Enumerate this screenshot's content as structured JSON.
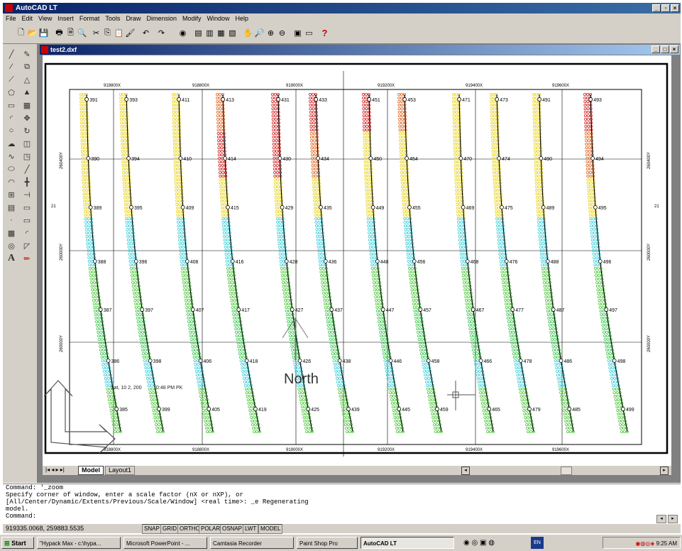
{
  "app": {
    "title": "AutoCAD LT"
  },
  "menu": [
    "File",
    "Edit",
    "View",
    "Insert",
    "Format",
    "Tools",
    "Draw",
    "Dimension",
    "Modify",
    "Window",
    "Help"
  ],
  "toolbar": {
    "help_glyph": "?"
  },
  "document": {
    "title": "test2.dxf"
  },
  "drawing": {
    "north_label": "North",
    "timestamp": "Sat, 10 2, 200",
    "timestamp2": "0:48 PM  PK",
    "x_labels_top": [
      "919800X",
      "918800X",
      "919000X",
      "919200X",
      "919400X",
      "919600X"
    ],
    "x_labels_bottom": [
      "918800X",
      "918800X",
      "919000X",
      "919200X",
      "919400X",
      "919600X"
    ],
    "y_labels_left": [
      "260400Y",
      "260000Y",
      "260000Y"
    ],
    "y_labels_right": [
      "260400Y",
      "260000Y",
      "260000Y"
    ],
    "label_21": "21",
    "lines": [
      {
        "stations": [
          "391",
          "390",
          "389",
          "388",
          "387",
          "386",
          "385"
        ]
      },
      {
        "stations": [
          "393",
          "394",
          "395",
          "396",
          "397",
          "398",
          "399"
        ]
      },
      {
        "stations": [
          "411",
          "410",
          "409",
          "408",
          "407",
          "406",
          "405"
        ]
      },
      {
        "stations": [
          "413",
          "414",
          "415",
          "416",
          "417",
          "418",
          "419"
        ]
      },
      {
        "stations": [
          "431",
          "430",
          "429",
          "428",
          "427",
          "426",
          "425"
        ]
      },
      {
        "stations": [
          "433",
          "434",
          "435",
          "436",
          "437",
          "438",
          "439"
        ]
      },
      {
        "stations": [
          "451",
          "450",
          "449",
          "448",
          "447",
          "446",
          "445"
        ]
      },
      {
        "stations": [
          "453",
          "454",
          "455",
          "456",
          "457",
          "458",
          "459"
        ]
      },
      {
        "stations": [
          "471",
          "470",
          "469",
          "468",
          "467",
          "466",
          "465"
        ]
      },
      {
        "stations": [
          "473",
          "474",
          "475",
          "476",
          "477",
          "478",
          "479"
        ]
      },
      {
        "stations": [
          "491",
          "490",
          "489",
          "488",
          "487",
          "486",
          "485"
        ]
      },
      {
        "stations": [
          "493",
          "494",
          "495",
          "496",
          "497",
          "498",
          "499"
        ]
      }
    ]
  },
  "tabs": {
    "model": "Model",
    "layout": "Layout1"
  },
  "command": {
    "lines": [
      "Command: '_zoom",
      "Specify corner of window, enter a scale factor (nX or nXP), or",
      "[All/Center/Dynamic/Extents/Previous/Scale/Window] <real time>: _e Regenerating",
      "model.",
      "Command:"
    ]
  },
  "status": {
    "coords": "919335.0068, 259883.5535",
    "buttons": [
      "SNAP",
      "GRID",
      "ORTHO",
      "POLAR",
      "OSNAP",
      "LWT",
      "MODEL"
    ]
  },
  "taskbar": {
    "start": "Start",
    "tasks": [
      "\"Hypack Max - c:\\hypa...",
      "Microsoft PowerPoint - ...",
      "Camtasia Recorder",
      "Paint Shop Pro",
      "AutoCAD LT"
    ],
    "clock": "9:25 AM"
  }
}
